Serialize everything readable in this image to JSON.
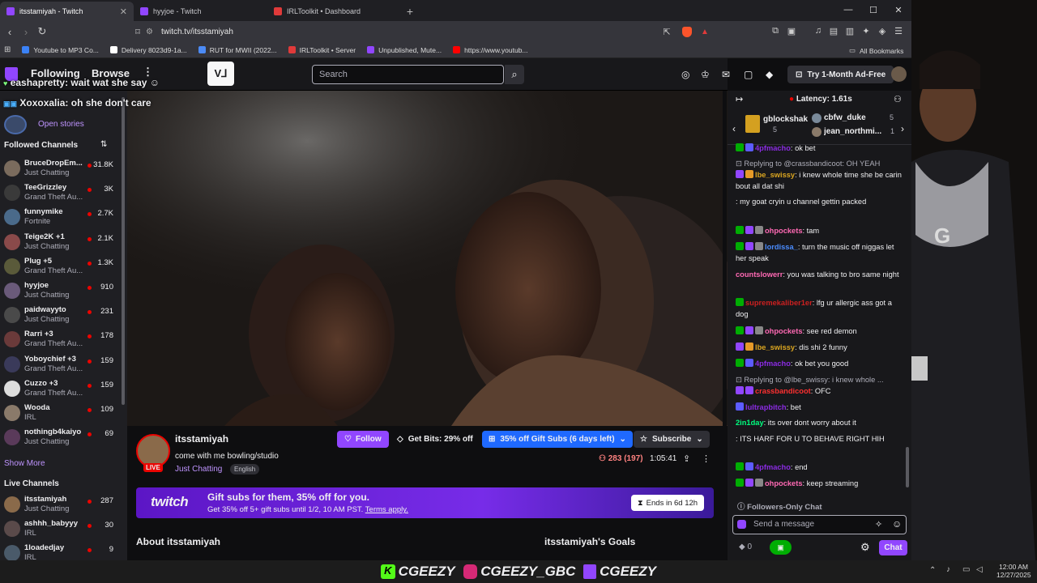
{
  "browser": {
    "tabs": [
      {
        "label": "itsstamiyah - Twitch",
        "color": "#9146ff",
        "active": true
      },
      {
        "label": "hyyjoe - Twitch",
        "color": "#9146ff",
        "active": false
      },
      {
        "label": "IRLToolkit • Dashboard",
        "color": "#e03a3a",
        "active": false
      }
    ],
    "url": "twitch.tv/itsstamiyah",
    "bookmarks": [
      {
        "label": "Youtube to MP3 Co...",
        "color": "#3b82f6"
      },
      {
        "label": "Delivery 8023d9-1a...",
        "color": "#ffffff"
      },
      {
        "label": "RUT for MWII (2022...",
        "color": "#4c8bf5"
      },
      {
        "label": "IRLToolkit • Server",
        "color": "#e03a3a"
      },
      {
        "label": "Unpublished, Mute...",
        "color": "#9146ff"
      },
      {
        "label": "https://www.youtub...",
        "color": "#ff0000"
      }
    ],
    "all_bookmarks": "All Bookmarks"
  },
  "topnav": {
    "following": "Following",
    "browse": "Browse",
    "search_placeholder": "Search",
    "ad_free": "Try 1-Month Ad-Free"
  },
  "overlay": {
    "line1_user": "eashapretty",
    "line1_text": "wait wat she say",
    "line2_user": "Xoxoxalia",
    "line2_text": "oh she don't care"
  },
  "sidebar": {
    "stories": "Open stories",
    "followed_title": "Followed Channels",
    "followed": [
      {
        "name": "BruceDropEm...",
        "game": "Just Chatting",
        "viewers": "31.8K",
        "color": "#7a6b5d"
      },
      {
        "name": "TeeGrizzley",
        "game": "Grand Theft Au...",
        "viewers": "3K",
        "color": "#3a3a3a"
      },
      {
        "name": "funnymike",
        "game": "Fortnite",
        "viewers": "2.7K",
        "color": "#4a6a8a"
      },
      {
        "name": "Teige2K +1",
        "game": "Just Chatting",
        "viewers": "2.1K",
        "color": "#8a4a4a"
      },
      {
        "name": "Plug +5",
        "game": "Grand Theft Au...",
        "viewers": "1.3K",
        "color": "#5a5a3a"
      },
      {
        "name": "hyyjoe",
        "game": "Just Chatting",
        "viewers": "910",
        "color": "#6a5a7a"
      },
      {
        "name": "paidwayyto",
        "game": "Just Chatting",
        "viewers": "231",
        "color": "#4a4a4a"
      },
      {
        "name": "Rarri +3",
        "game": "Grand Theft Au...",
        "viewers": "178",
        "color": "#6a3a3a"
      },
      {
        "name": "Yoboychief +3",
        "game": "Grand Theft Au...",
        "viewers": "159",
        "color": "#3a3a5a"
      },
      {
        "name": "Cuzzo +3",
        "game": "Grand Theft Au...",
        "viewers": "159",
        "color": "#dddddd"
      },
      {
        "name": "Wooda",
        "game": "IRL",
        "viewers": "109",
        "color": "#8a7a6a"
      },
      {
        "name": "nothingb4kaiyo",
        "game": "Just Chatting",
        "viewers": "69",
        "color": "#5a3a5a"
      }
    ],
    "show_more": "Show More",
    "live_title": "Live Channels",
    "live": [
      {
        "name": "itsstamiyah",
        "game": "Just Chatting",
        "viewers": "287",
        "color": "#8a6a4a"
      },
      {
        "name": "ashhh_babyyy",
        "game": "IRL",
        "viewers": "30",
        "color": "#5a4a4a"
      },
      {
        "name": "1loadedjay",
        "game": "IRL",
        "viewers": "9",
        "color": "#4a5a6a"
      }
    ]
  },
  "stream": {
    "channel": "itsstamiyah",
    "title": "come with me bowling/studio",
    "category": "Just Chatting",
    "tag": "English",
    "live": "LIVE",
    "follow": "Follow",
    "get_bits": "Get Bits: 29% off",
    "gift_subs": "35% off Gift Subs (6 days left)",
    "subscribe": "Subscribe",
    "viewers": "283 (197)",
    "uptime": "1:05:41"
  },
  "banner": {
    "logo": "twitch",
    "headline": "Gift subs for them, 35% off for you.",
    "subtext": "Get 35% off 5+ gift subs until 1/2, 10 AM PST.",
    "terms": "Terms apply.",
    "ends": "Ends in 6d 12h"
  },
  "about": {
    "title": "About itsstamiyah",
    "goals": "itsstamiyah's Goals"
  },
  "chat": {
    "latency": "Latency: 1.61s",
    "gifters": [
      {
        "name": "gblockshak",
        "count": "5"
      },
      {
        "name": "cbfw_duke",
        "count": "5"
      },
      {
        "name": "jean_northmi...",
        "count": "1"
      }
    ],
    "messages": [
      {
        "user": "4pfmacho",
        "color": "#8a2be2",
        "text": "ok bet",
        "badges": [
          "#00ad03",
          "#5c5cff"
        ]
      },
      {
        "reply": "Replying to @crassbandicoot: OH YEAH"
      },
      {
        "user": "lbe_swissy",
        "color": "#daa520",
        "text": "i knew whole time she be carin bout all dat shi",
        "badges": [
          "#9146ff",
          "#e69a28"
        ]
      },
      {
        "user": "",
        "color": "#1e3cff",
        "text": "my goat cryin u channel gettin packed",
        "badges": []
      },
      {
        "user": "ohpockets",
        "color": "#ff69b4",
        "text": "tam",
        "badges": [
          "#00ad03",
          "#9146ff",
          "#888888"
        ]
      },
      {
        "user": "lordissa_",
        "color": "#4a8cff",
        "text": "turn the music off niggas let her speak",
        "badges": [
          "#00ad03",
          "#9146ff",
          "#888888"
        ]
      },
      {
        "user": "countslowerr",
        "color": "#ff69b4",
        "text": "you was talking to bro same night",
        "badges": []
      },
      {
        "user": "supremekaliber1er",
        "color": "#cc2020",
        "text": "lfg ur allergic ass got a dog",
        "badges": [
          "#00ad03"
        ]
      },
      {
        "user": "ohpockets",
        "color": "#ff69b4",
        "text": "see red demon",
        "badges": [
          "#00ad03",
          "#9146ff",
          "#888888"
        ]
      },
      {
        "user": "lbe_swissy",
        "color": "#daa520",
        "text": "dis shi 2 funny",
        "badges": [
          "#9146ff",
          "#e69a28"
        ]
      },
      {
        "user": "4pfmacho",
        "color": "#8a2be2",
        "text": "ok bet you good",
        "badges": [
          "#00ad03",
          "#5c5cff"
        ]
      },
      {
        "reply": "Replying to @lbe_swissy: i knew whole ..."
      },
      {
        "user": "crassbandicoot",
        "color": "#ff3030",
        "text": "OFC",
        "badges": [
          "#9146ff",
          "#9146ff"
        ]
      },
      {
        "user": "lultrapbitch",
        "color": "#8a2be2",
        "text": "bet",
        "badges": [
          "#5c5cff"
        ]
      },
      {
        "user": "2in1day",
        "color": "#00ff7f",
        "text": "its over dont worry about it",
        "badges": []
      },
      {
        "user": "",
        "color": "#1e3cff",
        "text": "ITS HARF FOR U TO BEHAVE RIGHT HIH",
        "badges": []
      },
      {
        "user": "4pfmacho",
        "color": "#8a2be2",
        "text": "end",
        "badges": [
          "#00ad03",
          "#5c5cff"
        ]
      },
      {
        "user": "ohpockets",
        "color": "#ff69b4",
        "text": "keep streaming",
        "badges": [
          "#00ad03",
          "#9146ff",
          "#888888"
        ]
      }
    ],
    "followers_only": "Followers-Only Chat",
    "input_placeholder": "Send a message",
    "points": "0",
    "chat_button": "Chat"
  },
  "taskbar": {
    "overlay_names": [
      "CGEEZY",
      "CGEEZY_GBC",
      "CGEEZY"
    ],
    "time": "12:00 AM",
    "date": "12/27/2025"
  }
}
